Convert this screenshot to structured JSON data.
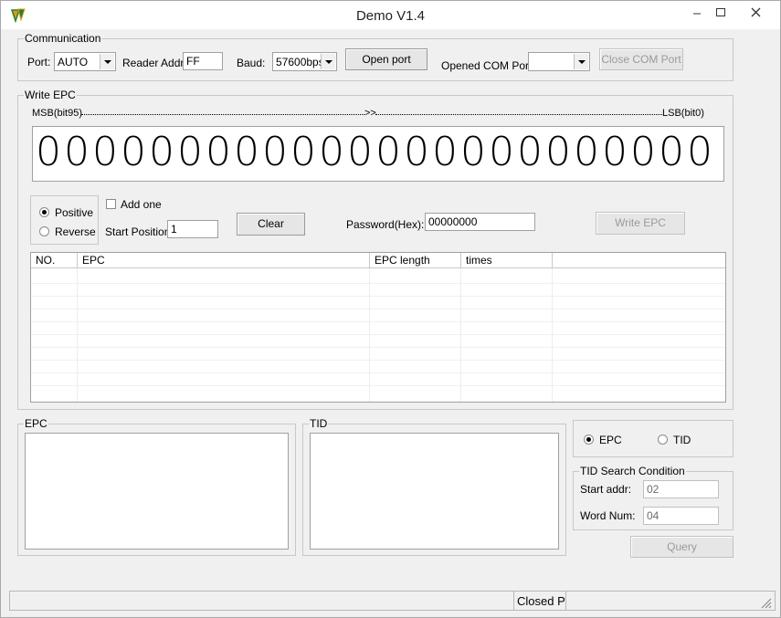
{
  "window": {
    "title": "Demo V1.4"
  },
  "communication": {
    "group_label": "Communication",
    "port_label": "Port:",
    "port_value": "AUTO",
    "reader_addr_label": "Reader Addr:",
    "reader_addr_value": "FF",
    "baud_label": "Baud:",
    "baud_value": "57600bps",
    "open_port_label": "Open port",
    "opened_com_label": "Opened COM Port:",
    "opened_com_value": "",
    "close_com_label": "Close COM Port"
  },
  "write_epc": {
    "group_label": "Write EPC",
    "msb_label": "MSB(bit95)",
    "arrow_label": ">>",
    "lsb_label": "LSB(bit0)",
    "digits": [
      "0",
      "0",
      "0",
      "0",
      "0",
      "0",
      "0",
      "0",
      "0",
      "0",
      "0",
      "0",
      "0",
      "0",
      "0",
      "0",
      "0",
      "0",
      "0",
      "0",
      "0",
      "0",
      "0",
      "0"
    ],
    "positive_label": "Positive",
    "reverse_label": "Reverse",
    "direction_selected": "Positive",
    "add_one_label": "Add one",
    "add_one_checked": false,
    "start_position_label": "Start Position:",
    "start_position_value": "1",
    "clear_label": "Clear",
    "password_label": "Password(Hex):",
    "password_value": "00000000",
    "write_button_label": "Write EPC"
  },
  "table": {
    "columns": [
      "NO.",
      "EPC",
      "EPC length",
      "times",
      ""
    ],
    "rows": []
  },
  "bottom": {
    "epc_group_label": "EPC",
    "tid_group_label": "TID",
    "mode_epc_label": "EPC",
    "mode_tid_label": "TID",
    "mode_selected": "EPC",
    "tid_search_label": "TID Search Condition",
    "start_addr_label": "Start addr:",
    "start_addr_value": "02",
    "word_num_label": "Word Num:",
    "word_num_value": "04",
    "query_label": "Query"
  },
  "status": {
    "text": "Closed P"
  }
}
